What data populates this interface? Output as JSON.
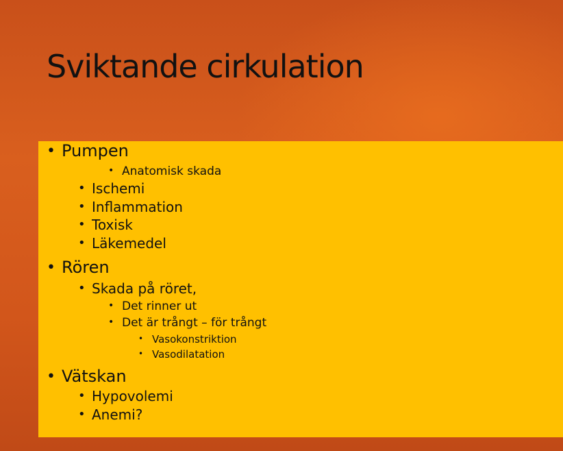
{
  "slide": {
    "title": "Sviktande cirkulation",
    "bullet_glyph": "•",
    "items": [
      {
        "level": 1,
        "text": "Pumpen"
      },
      {
        "level": 3,
        "text": "Anatomisk skada"
      },
      {
        "level": 2,
        "text": "Ischemi"
      },
      {
        "level": 2,
        "text": "Inflammation"
      },
      {
        "level": 2,
        "text": "Toxisk"
      },
      {
        "level": 2,
        "text": "Läkemedel"
      },
      {
        "level": 1,
        "text": "Rören"
      },
      {
        "level": 2,
        "text": "Skada på röret,"
      },
      {
        "level": 3,
        "text": "Det rinner ut"
      },
      {
        "level": 3,
        "text": "Det är trångt – för trångt"
      },
      {
        "level": 4,
        "text": "Vasokonstriktion"
      },
      {
        "level": 4,
        "text": "Vasodilatation"
      },
      {
        "level": 1,
        "text": "Vätskan"
      },
      {
        "level": 2,
        "text": "Hypovolemi"
      },
      {
        "level": 2,
        "text": "Anemi?"
      }
    ]
  },
  "colors": {
    "background": "#d95f1e",
    "content_box": "#ffc000",
    "text": "#111111"
  }
}
